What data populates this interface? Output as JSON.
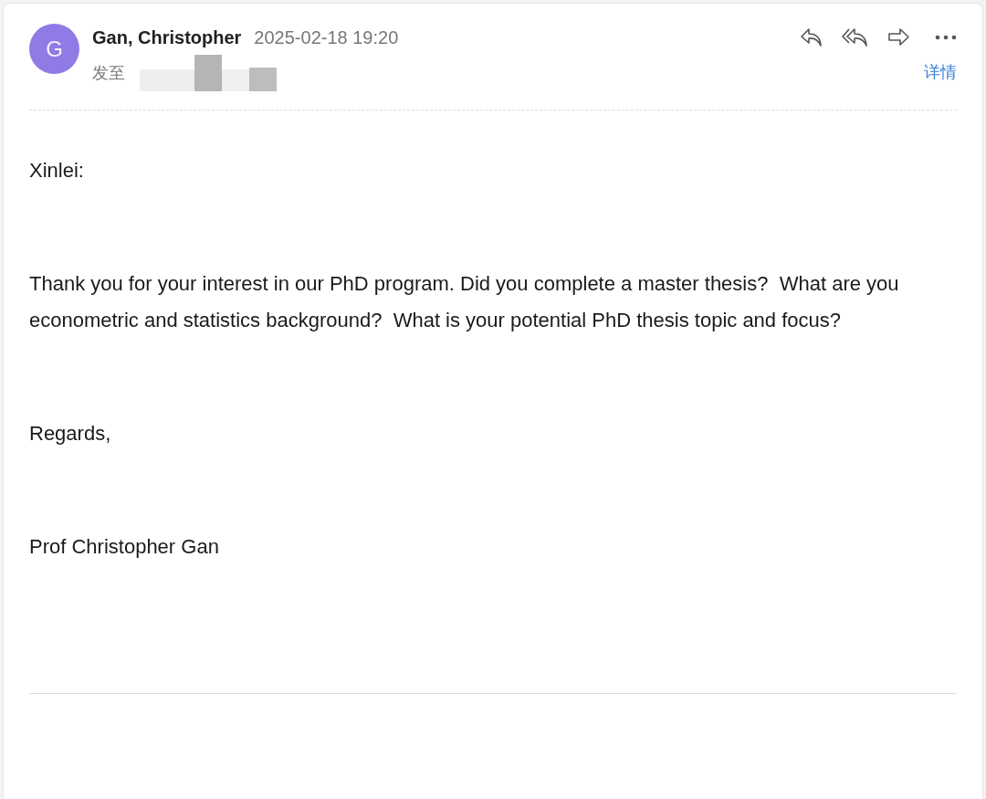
{
  "sender": {
    "avatar_letter": "G",
    "name": "Gan, Christopher",
    "date": "2025-02-18 19:20"
  },
  "recipient": {
    "label": "发至"
  },
  "actions": {
    "details_link": "详情"
  },
  "body": [
    "Xinlei:",
    "Thank you for your interest in our PhD program. Did you complete a master thesis?  What are you econometric and statistics background?  What is your potential PhD thesis topic and focus?",
    "Regards,",
    "Prof Christopher Gan"
  ]
}
